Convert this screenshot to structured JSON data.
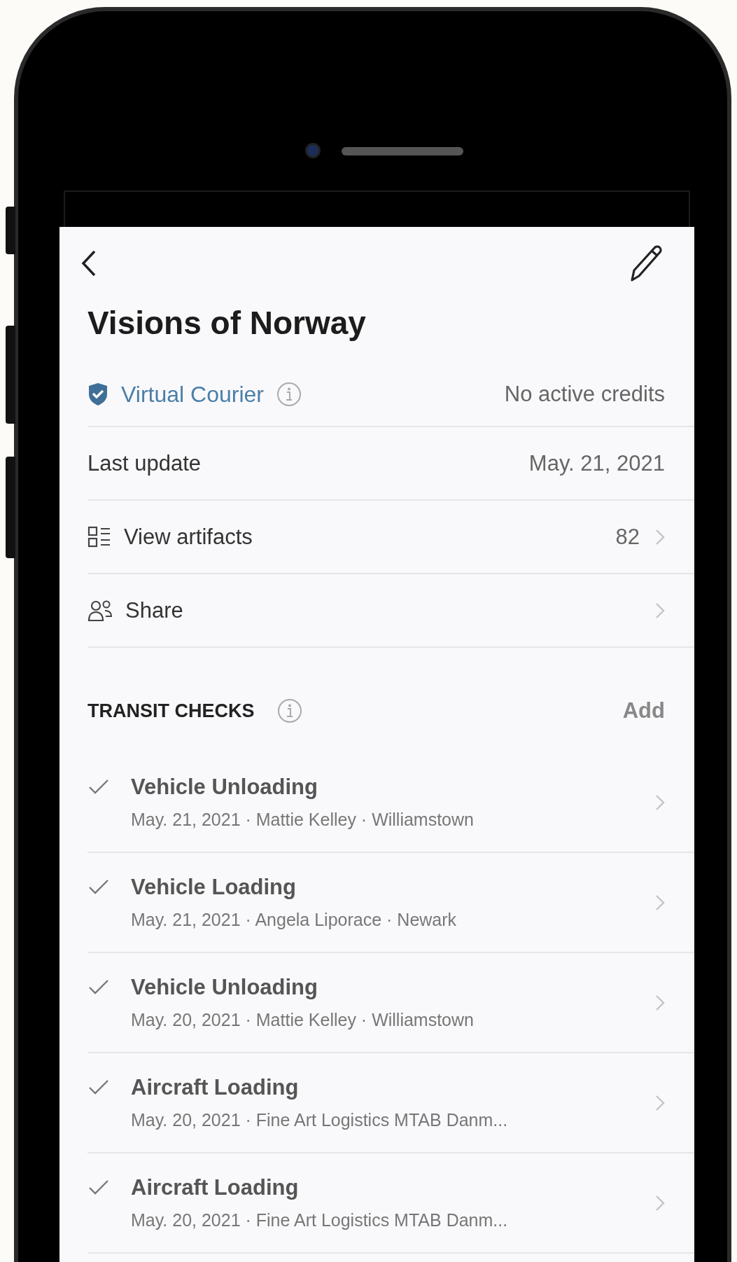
{
  "title": "Visions of Norway",
  "courier": {
    "label": "Virtual Courier",
    "status": "No active credits"
  },
  "rows": [
    {
      "kind": "value",
      "label": "Last update",
      "value": "May. 21, 2021"
    },
    {
      "kind": "artifacts",
      "label": "View artifacts",
      "value": "82"
    },
    {
      "kind": "share",
      "label": "Share"
    }
  ],
  "transit_checks": {
    "heading": "TRANSIT CHECKS",
    "action": "Add",
    "items": [
      {
        "title": "Vehicle Unloading",
        "subtitle": "May. 21, 2021 · Mattie Kelley · Williamstown",
        "completed": true
      },
      {
        "title": "Vehicle Loading",
        "subtitle": "May. 21, 2021 · Angela Liporace · Newark",
        "completed": true
      },
      {
        "title": "Vehicle Unloading",
        "subtitle": "May. 20, 2021 · Mattie Kelley · Williamstown",
        "completed": true
      },
      {
        "title": "Aircraft Loading",
        "subtitle": "May. 20, 2021 · Fine Art Logistics MTAB Danm...",
        "completed": true
      },
      {
        "title": "Aircraft Loading",
        "subtitle": "May. 20, 2021 · Fine Art Logistics MTAB Danm...",
        "completed": true
      }
    ]
  }
}
